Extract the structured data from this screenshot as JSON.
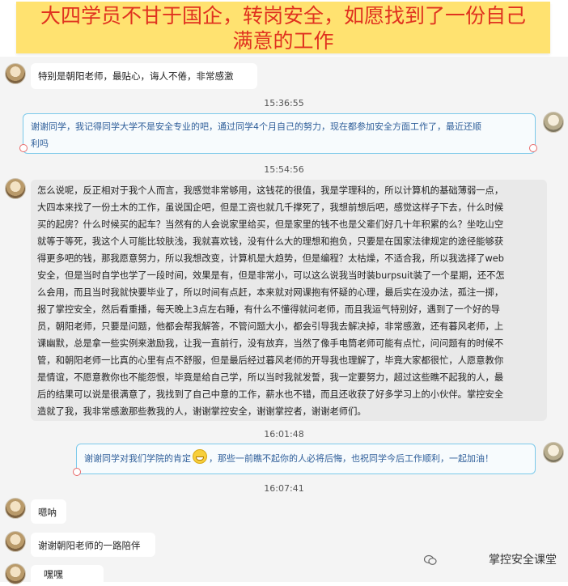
{
  "banner": {
    "line1": "大四学员不甘于国企，转岗安全，如愿找到了一份自己",
    "line2": "满意的工作"
  },
  "messages": [
    {
      "text": "特别是朝阳老师，最贴心，诲人不倦，非常感激"
    },
    {
      "time": "15:36:55"
    },
    {
      "text_l1": "谢谢同学，我记得同学大学不是安全专业的吧，通过同学4个月自己的努力，现在都参加安全方面工作了，最近还顺",
      "text_l2": "利吗"
    },
    {
      "time": "15:54:56"
    },
    {
      "lines": [
        "怎么说呢，反正相对于我个人而言，我感觉非常够用，这钱花的很值，我是学理科的，所以计算机的基础薄弱一点，",
        "大四本来找了一份土木的工作，虽说国企吧，但是工资也就几千撑死了，我想前想后吧，感觉这样子下去，什么时候",
        "买的起房？什么时候买的起车？当然有的人会说家里给买，但是家里的钱不也是父辈们好几十年积累的么？坐吃山空",
        "就等于等死，我这个人可能比较肤浅，我就喜欢钱，没有什么大的理想和抱负，只要是在国家法律规定的途径能够获",
        "得更多吧的钱，那我愿意努力，所以我想改变，计算机是大趋势，但是编程？太枯燥，不适合我，所以我选择了web",
        "安全，但是当时自学也学了一段时间，效果是有，但是非常小，可以这么说我当时装burpsuit装了一个星期，还不怎",
        "么会用，而且当时我就快要毕业了，所以时间有点赶，本来就对网课抱有怀疑的心理，最后实在没办法，孤注一掷，",
        "报了掌控安全，然后看重播，每天晚上3点左右睡，有什么不懂得就问老师，而且我运气特别好，遇到了一个好的导",
        "员，朝阳老师，只要是问题，他都会帮我解答，不管问题大小，都会引导我去解决掉，非常感激，还有暮风老师，上",
        "课幽默，总是拿一些实例来激励我，让我一直前行，没有放弃，当然了像手电筒老师可能有点忙，问问题有的时候不",
        "管，和朝阳老师一比真的心里有点不舒服，但是最后经过暮风老师的开导我也理解了，毕竟大家都很忙，人愿意教你",
        "是情谊，不愿意教你也不能怨恨，毕竟是给自己学，所以当时我就发誓，我一定要努力，超过这些瞧不起我的人，最",
        "后的结果可以说是很满意了，我找到了自己中意的工作，薪水也不错，而且还收获了好多学习上的小伙伴。掌控安全",
        "造就了我，我非常感激那些教我的人，谢谢掌控安全，谢谢掌控者，谢谢老师们。"
      ]
    },
    {
      "time": "16:01:48"
    },
    {
      "text_before": "谢谢同学对我们学院的肯定",
      "text_after": "，那些一前瞧不起你的人必将后悔，也祝同学今后工作顺利，一起加油！"
    },
    {
      "time": "16:07:41"
    },
    {
      "text": "嗯呐"
    },
    {
      "text": "谢谢朝阳老师的一路陪伴"
    },
    {
      "text": "嘿嘿"
    }
  ],
  "watermark": {
    "text": "掌控安全课堂",
    "icon": "wechat-official-account-icon"
  }
}
